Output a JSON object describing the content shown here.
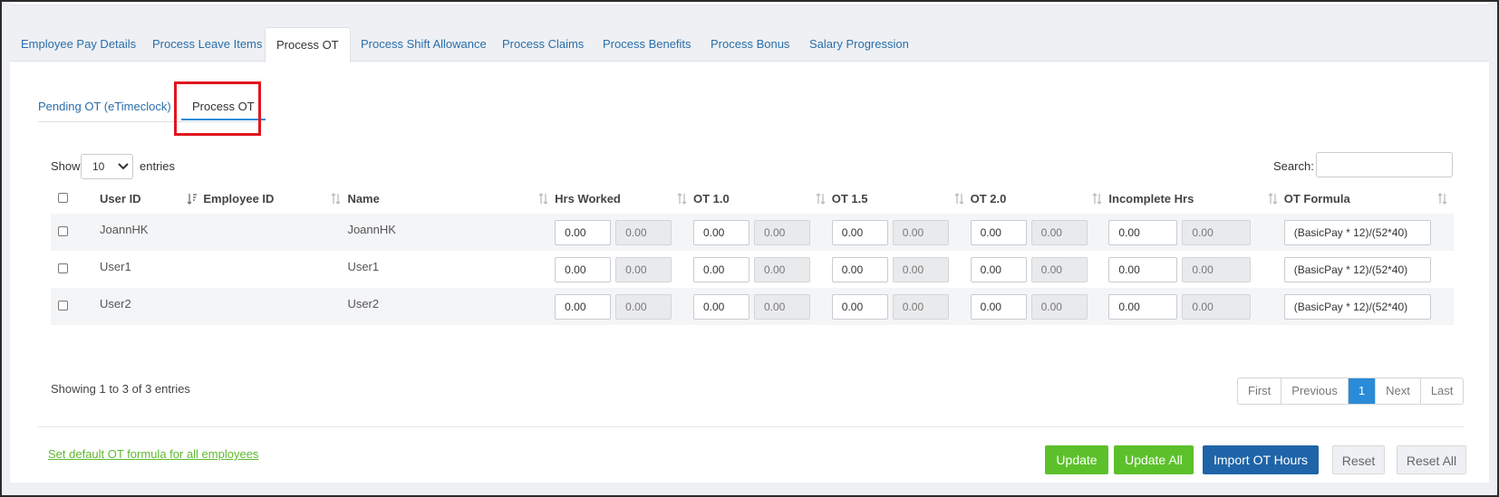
{
  "tabs": [
    {
      "label": "Employee Pay Details"
    },
    {
      "label": "Process Leave Items"
    },
    {
      "label": "Process OT"
    },
    {
      "label": "Process Shift Allowance"
    },
    {
      "label": "Process Claims"
    },
    {
      "label": "Process Benefits"
    },
    {
      "label": "Process Bonus"
    },
    {
      "label": "Salary Progression"
    }
  ],
  "subtabs": [
    {
      "label": "Pending OT (eTimeclock)"
    },
    {
      "label": "Process OT"
    }
  ],
  "controls": {
    "show_label": "Show",
    "page_size": "10",
    "entries_label": "entries",
    "search_label": "Search:",
    "search_value": ""
  },
  "table": {
    "headers": [
      "User ID",
      "Employee ID",
      "Name",
      "Hrs Worked",
      "OT 1.0",
      "OT 1.5",
      "OT 2.0",
      "Incomplete Hrs",
      "OT Formula"
    ],
    "rows": [
      {
        "user_id": "JoannHK",
        "employee_id": "",
        "name": "JoannHK",
        "hrs": [
          "0.00",
          "0.00"
        ],
        "ot10": [
          "0.00",
          "0.00"
        ],
        "ot15": [
          "0.00",
          "0.00"
        ],
        "ot20": [
          "0.00",
          "0.00"
        ],
        "incomplete": [
          "0.00",
          "0.00"
        ],
        "formula": "(BasicPay * 12)/(52*40)"
      },
      {
        "user_id": "User1",
        "employee_id": "",
        "name": "User1",
        "hrs": [
          "0.00",
          "0.00"
        ],
        "ot10": [
          "0.00",
          "0.00"
        ],
        "ot15": [
          "0.00",
          "0.00"
        ],
        "ot20": [
          "0.00",
          "0.00"
        ],
        "incomplete": [
          "0.00",
          "0.00"
        ],
        "formula": "(BasicPay * 12)/(52*40)"
      },
      {
        "user_id": "User2",
        "employee_id": "",
        "name": "User2",
        "hrs": [
          "0.00",
          "0.00"
        ],
        "ot10": [
          "0.00",
          "0.00"
        ],
        "ot15": [
          "0.00",
          "0.00"
        ],
        "ot20": [
          "0.00",
          "0.00"
        ],
        "incomplete": [
          "0.00",
          "0.00"
        ],
        "formula": "(BasicPay * 12)/(52*40)"
      }
    ]
  },
  "info": "Showing 1 to 3 of 3 entries",
  "pager": {
    "first": "First",
    "previous": "Previous",
    "current": "1",
    "next": "Next",
    "last": "Last"
  },
  "footer": {
    "link": "Set default OT formula for all employees",
    "update": "Update",
    "update_all": "Update All",
    "import": "Import OT Hours",
    "reset": "Reset",
    "reset_all": "Reset All"
  },
  "colors": {
    "accent": "#2a8bd8",
    "link": "#2a6eab",
    "green": "#5cc02b",
    "blue_button": "#1f64a8",
    "highlight": "#e0161e"
  }
}
